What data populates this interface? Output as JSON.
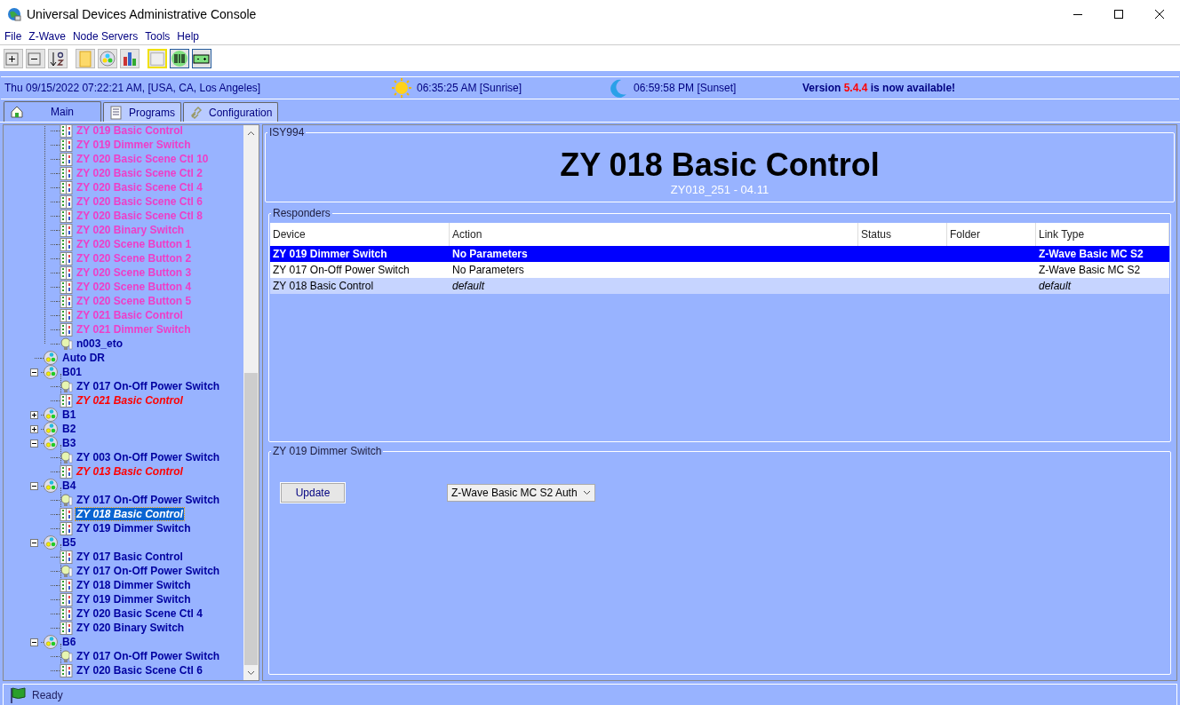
{
  "window": {
    "title": "Universal Devices Administrative Console"
  },
  "menu": [
    {
      "label": "File"
    },
    {
      "label": "Z-Wave"
    },
    {
      "label": "Node Servers"
    },
    {
      "label": "Tools"
    },
    {
      "label": "Help"
    }
  ],
  "info_bar": {
    "datetime": "Thu 09/15/2022 07:22:21 AM,  [USA, CA, Los Angeles]",
    "sunrise": "06:35:25 AM [Sunrise]",
    "sunset": "06:59:58 PM [Sunset]",
    "update_notice": {
      "prefix": "Version",
      "version": "5.4.4",
      "suffix": "is now available!"
    }
  },
  "tabs": [
    {
      "label": "Main",
      "kind": "home",
      "selected": true
    },
    {
      "label": "Programs",
      "kind": "list",
      "selected": false
    },
    {
      "label": "Configuration",
      "kind": "link",
      "selected": false
    }
  ],
  "tree": {
    "items": [
      {
        "children": [
          {
            "label": "ZY 019 Basic Control",
            "kind": "device",
            "color": "#ee3ec8",
            "italic": false,
            "selected": false
          },
          {
            "label": "ZY 019 Dimmer Switch",
            "kind": "device",
            "color": "#ee3ec8",
            "italic": false,
            "selected": false
          },
          {
            "label": "ZY 020 Basic Scene Ctl 10",
            "kind": "device",
            "color": "#ee3ec8",
            "italic": false,
            "selected": false
          },
          {
            "label": "ZY 020 Basic Scene Ctl 2",
            "kind": "device",
            "color": "#ee3ec8",
            "italic": false,
            "selected": false
          },
          {
            "label": "ZY 020 Basic Scene Ctl 4",
            "kind": "device",
            "color": "#ee3ec8",
            "italic": false,
            "selected": false
          },
          {
            "label": "ZY 020 Basic Scene Ctl 6",
            "kind": "device",
            "color": "#ee3ec8",
            "italic": false,
            "selected": false
          },
          {
            "label": "ZY 020 Basic Scene Ctl 8",
            "kind": "device",
            "color": "#ee3ec8",
            "italic": false,
            "selected": false
          },
          {
            "label": "ZY 020 Binary Switch",
            "kind": "device",
            "color": "#ee3ec8",
            "italic": false,
            "selected": false
          },
          {
            "label": "ZY 020 Scene Button 1",
            "kind": "device",
            "color": "#ee3ec8",
            "italic": false,
            "selected": false
          },
          {
            "label": "ZY 020 Scene Button 2",
            "kind": "device",
            "color": "#ee3ec8",
            "italic": false,
            "selected": false
          },
          {
            "label": "ZY 020 Scene Button 3",
            "kind": "device",
            "color": "#ee3ec8",
            "italic": false,
            "selected": false
          },
          {
            "label": "ZY 020 Scene Button 4",
            "kind": "device",
            "color": "#ee3ec8",
            "italic": false,
            "selected": false
          },
          {
            "label": "ZY 020 Scene Button 5",
            "kind": "device",
            "color": "#ee3ec8",
            "italic": false,
            "selected": false
          },
          {
            "label": "ZY 021 Basic Control",
            "kind": "device",
            "color": "#ee3ec8",
            "italic": false,
            "selected": false
          },
          {
            "label": "ZY 021 Dimmer Switch",
            "kind": "device",
            "color": "#ee3ec8",
            "italic": false,
            "selected": false
          },
          {
            "label": "n003_eto",
            "kind": "bulb",
            "color": "#0000a0",
            "italic": false,
            "selected": false
          }
        ]
      },
      {
        "label": "Auto DR",
        "kind": "scene",
        "color": "#0000a0",
        "italic": false,
        "selected": false
      },
      {
        "label": "B01",
        "kind": "scene",
        "color": "#0000a0",
        "italic": false,
        "selected": false,
        "expanded": true,
        "children": [
          {
            "label": "ZY 017 On-Off Power Switch",
            "kind": "bulb",
            "color": "#0000a0",
            "italic": false,
            "selected": false
          },
          {
            "label": "ZY 021 Basic Control",
            "kind": "device",
            "color": "#ff0000",
            "italic": true,
            "selected": false
          }
        ]
      },
      {
        "label": "B1",
        "kind": "scene",
        "color": "#0000a0",
        "italic": false,
        "selected": false,
        "expanded": false
      },
      {
        "label": "B2",
        "kind": "scene",
        "color": "#0000a0",
        "italic": false,
        "selected": false,
        "expanded": false
      },
      {
        "label": "B3",
        "kind": "scene",
        "color": "#0000a0",
        "italic": false,
        "selected": false,
        "expanded": true,
        "children": [
          {
            "label": "ZY 003 On-Off Power Switch",
            "kind": "bulb",
            "color": "#0000a0",
            "italic": false,
            "selected": false
          },
          {
            "label": "ZY 013 Basic Control",
            "kind": "device",
            "color": "#ff0000",
            "italic": true,
            "selected": false
          }
        ]
      },
      {
        "label": "B4",
        "kind": "scene",
        "color": "#0000a0",
        "italic": false,
        "selected": false,
        "expanded": true,
        "children": [
          {
            "label": "ZY 017 On-Off Power Switch",
            "kind": "bulb",
            "color": "#0000a0",
            "italic": false,
            "selected": false
          },
          {
            "label": "ZY 018 Basic Control",
            "kind": "device",
            "italic": true,
            "selected": true
          },
          {
            "label": "ZY 019 Dimmer Switch",
            "kind": "device",
            "color": "#0000a0",
            "italic": false,
            "selected": false
          }
        ]
      },
      {
        "label": "B5",
        "kind": "scene",
        "color": "#0000a0",
        "italic": false,
        "selected": false,
        "expanded": true,
        "children": [
          {
            "label": "ZY 017 Basic Control",
            "kind": "device",
            "color": "#0000a0",
            "italic": false,
            "selected": false
          },
          {
            "label": "ZY 017 On-Off Power Switch",
            "kind": "bulb",
            "color": "#0000a0",
            "italic": false,
            "selected": false
          },
          {
            "label": "ZY 018 Dimmer Switch",
            "kind": "device",
            "color": "#0000a0",
            "italic": false,
            "selected": false
          },
          {
            "label": "ZY 019 Dimmer Switch",
            "kind": "device",
            "color": "#0000a0",
            "italic": false,
            "selected": false
          },
          {
            "label": "ZY 020 Basic Scene Ctl 4",
            "kind": "device",
            "color": "#0000a0",
            "italic": false,
            "selected": false
          },
          {
            "label": "ZY 020 Binary Switch",
            "kind": "device",
            "color": "#0000a0",
            "italic": false,
            "selected": false
          }
        ]
      },
      {
        "label": "B6",
        "kind": "scene",
        "color": "#0000a0",
        "italic": false,
        "selected": false,
        "expanded": true,
        "children": [
          {
            "label": "ZY 017 On-Off Power Switch",
            "kind": "bulb",
            "color": "#0000a0",
            "italic": false,
            "selected": false
          },
          {
            "label": "ZY 020 Basic Scene Ctl 6",
            "kind": "device",
            "color": "#0000a0",
            "italic": false,
            "selected": false
          }
        ]
      }
    ]
  },
  "detail": {
    "group_label": "ISY994",
    "title": "ZY 018 Basic Control",
    "subtitle": "ZY018_251 - 04.11",
    "responders": {
      "label": "Responders",
      "columns": [
        "Device",
        "Action",
        "Status",
        "Folder",
        "Link Type"
      ],
      "rows": [
        {
          "device": "ZY 019 Dimmer Switch",
          "action": "No Parameters",
          "link_type": "Z-Wave Basic MC S2",
          "selected": true,
          "is_default": false
        },
        {
          "device": "ZY 017 On-Off Power Switch",
          "action": "No Parameters",
          "link_type": "Z-Wave Basic MC S2",
          "selected": false,
          "is_default": false
        },
        {
          "device": "ZY 018 Basic Control",
          "action": "default",
          "link_type": "default",
          "selected": false,
          "is_default": true
        }
      ]
    },
    "editor": {
      "label": "ZY 019 Dimmer Switch",
      "button": "Update",
      "link_type": "Z-Wave Basic MC S2 Auth"
    }
  },
  "status_bar": {
    "text": "Ready"
  }
}
